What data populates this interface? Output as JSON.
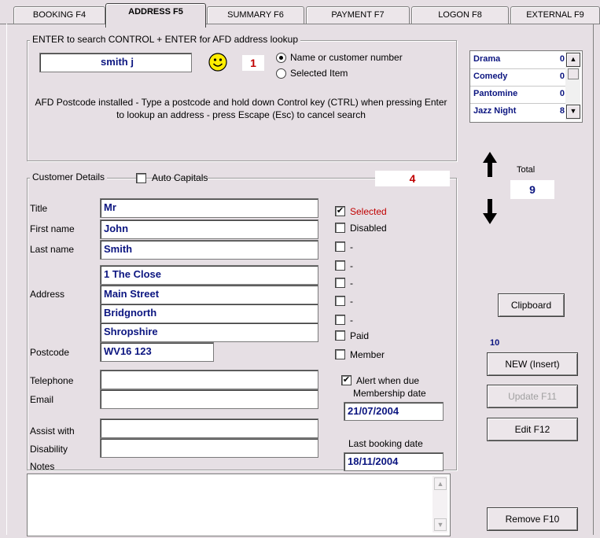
{
  "tabs": [
    {
      "label": "BOOKING F4"
    },
    {
      "label": "ADDRESS F5"
    },
    {
      "label": "SUMMARY F6"
    },
    {
      "label": "PAYMENT F7"
    },
    {
      "label": "LOGON F8"
    },
    {
      "label": "EXTERNAL F9"
    }
  ],
  "search": {
    "legend": "ENTER to search   CONTROL + ENTER for AFD address lookup",
    "value": "smith j",
    "badge": "1",
    "radio_name": "Name or customer number",
    "radio_selected": "Selected Item",
    "info": "AFD Postcode installed  -  Type a postcode and hold down Control key (CTRL) when pressing Enter to lookup an address - press Escape (Esc) to cancel search"
  },
  "categories": [
    {
      "name": "Drama",
      "count": "0"
    },
    {
      "name": "Comedy",
      "count": "0"
    },
    {
      "name": "Pantomine",
      "count": "0"
    },
    {
      "name": "Jazz Night",
      "count": "8"
    }
  ],
  "total": {
    "label": "Total",
    "value": "9"
  },
  "customer": {
    "legend": "Customer Details",
    "auto_caps": "Auto Capitals",
    "counter": "4",
    "labels": {
      "title": "Title",
      "first": "First name",
      "last": "Last name",
      "address": "Address",
      "postcode": "Postcode",
      "telephone": "Telephone",
      "email": "Email",
      "assist": "Assist with",
      "disability": "Disability",
      "notes": "Notes"
    },
    "title": "Mr",
    "first": "John",
    "last": "Smith",
    "address1": "1 The Close",
    "address2": "Main Street",
    "address3": "Bridgnorth",
    "address4": "Shropshire",
    "postcode": "WV16 123",
    "telephone": "",
    "email": "",
    "assist": "",
    "disability": ""
  },
  "flags": {
    "selected": "Selected",
    "disabled": "Disabled",
    "dash": "-",
    "paid": "Paid",
    "member": "Member",
    "alert": "Alert when due",
    "membership_date_label": "Membership date",
    "membership_date": "21/07/2004",
    "last_booking_label": "Last booking date",
    "last_booking": "18/11/2004"
  },
  "buttons": {
    "clipboard": "Clipboard",
    "count": "10",
    "new": "NEW (Insert)",
    "update": "Update  F11",
    "edit": "Edit  F12",
    "remove": "Remove  F10"
  },
  "colors": {
    "selected_text": "#c00000",
    "accent_blue": "#0b1580",
    "badge_red": "#c00000"
  }
}
